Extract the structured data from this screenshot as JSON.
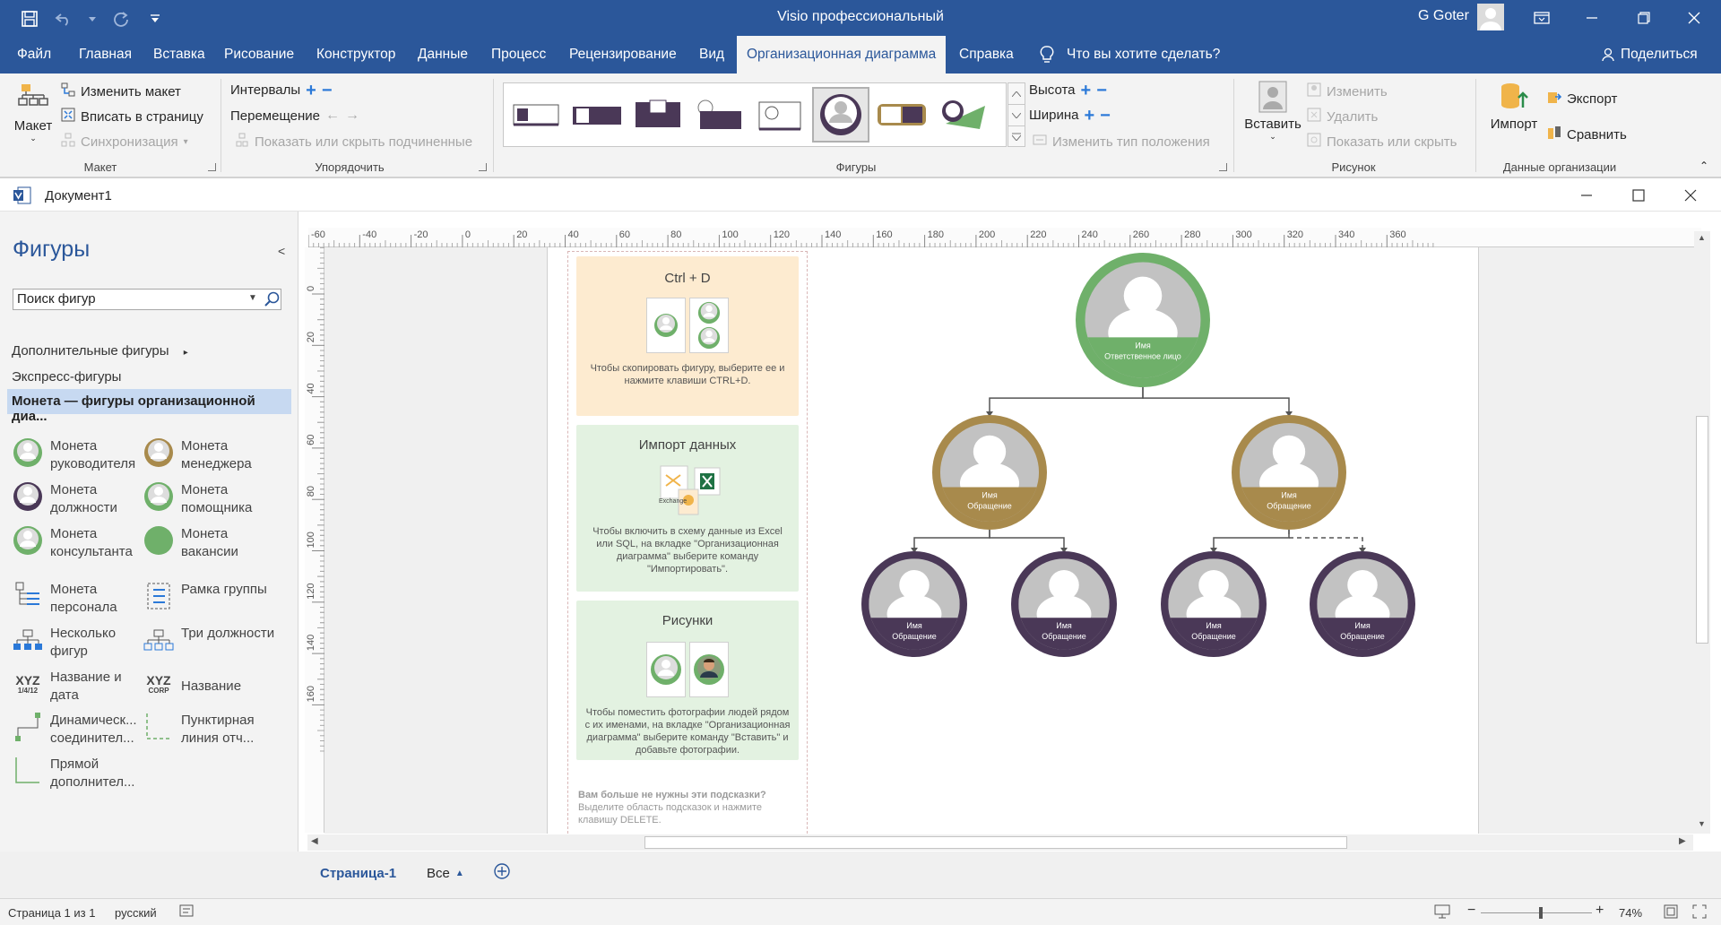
{
  "app": {
    "title": "Visio профессиональный",
    "user": "G Goter",
    "doc_title": "Документ1"
  },
  "tabs": [
    {
      "label": "Файл"
    },
    {
      "label": "Главная"
    },
    {
      "label": "Вставка"
    },
    {
      "label": "Рисование"
    },
    {
      "label": "Конструктор"
    },
    {
      "label": "Данные"
    },
    {
      "label": "Процесс"
    },
    {
      "label": "Рецензирование"
    },
    {
      "label": "Вид"
    },
    {
      "label": "Организационная диаграмма"
    },
    {
      "label": "Справка"
    }
  ],
  "tell_me": "Что вы хотите сделать?",
  "share": "Поделиться",
  "ribbon": {
    "layout": {
      "big_button": "Макет",
      "change_layout": "Изменить макет",
      "fit_to_page": "Вписать в страницу",
      "sync": "Синхронизация",
      "label": "Макет"
    },
    "arrange": {
      "spacing": "Интервалы",
      "move": "Перемещение",
      "show_hide": "Показать или скрыть подчиненные",
      "label": "Упорядочить"
    },
    "shapes": {
      "height": "Высота",
      "width": "Ширина",
      "change_position_type": "Изменить тип положения",
      "label": "Фигуры"
    },
    "picture": {
      "insert": "Вставить",
      "change": "Изменить",
      "delete": "Удалить",
      "show_hide": "Показать или скрыть",
      "label": "Рисунок"
    },
    "org_data": {
      "import": "Импорт",
      "export": "Экспорт",
      "compare": "Сравнить",
      "label": "Данные организации"
    }
  },
  "shapes_pane": {
    "title": "Фигуры",
    "search_placeholder": "Поиск фигур",
    "more_shapes": "Дополнительные фигуры",
    "quick_shapes": "Экспресс-фигуры",
    "stencil": "Монета — фигуры организационной диа...",
    "items": [
      {
        "label": "Монета руководителя",
        "color": "#6fb06a"
      },
      {
        "label": "Монета менеджера",
        "color": "#a88a4c"
      },
      {
        "label": "Монета должности",
        "color": "#4a3857"
      },
      {
        "label": "Монета помощника",
        "color": "#6fb06a"
      },
      {
        "label": "Монета консультанта",
        "color": "#6fb06a"
      },
      {
        "label": "Монета вакансии",
        "color": "#6fb06a"
      },
      {
        "label": "Монета персонала"
      },
      {
        "label": "Рамка группы"
      },
      {
        "label": "Несколько фигур"
      },
      {
        "label": "Три должности"
      },
      {
        "label": "Название и дата",
        "icon_text": "XYZ",
        "icon_sub": "1/4/12"
      },
      {
        "label": "Название",
        "icon_text": "XYZ",
        "icon_sub": "CORP"
      },
      {
        "label": "Динамическ... соединител..."
      },
      {
        "label": "Пунктирная линия отч..."
      },
      {
        "label": "Прямой дополнител..."
      }
    ]
  },
  "ruler": {
    "h_labels": [
      "-60",
      "-40",
      "-20",
      "0",
      "20",
      "40",
      "60",
      "80",
      "100",
      "120",
      "140",
      "160",
      "180",
      "200",
      "220",
      "240",
      "260",
      "280",
      "300",
      "320",
      "340",
      "360"
    ],
    "v_labels": [
      "0",
      "20",
      "40",
      "60",
      "80",
      "100",
      "120",
      "140",
      "160"
    ]
  },
  "tips": [
    {
      "title": "Ctrl + D",
      "desc": "Чтобы скопировать фигуру, выберите ее и нажмите клавиши CTRL+D."
    },
    {
      "title": "Импорт данных",
      "desc": "Чтобы включить в схему данные из Excel или SQL, на вкладке \"Организационная диаграмма\" выберите команду \"Импортировать\".",
      "icon_text": "Exchange"
    },
    {
      "title": "Рисунки",
      "desc": "Чтобы поместить фотографии людей рядом с их именами, на вкладке \"Организационная диаграмма\" выберите команду \"Вставить\" и добавьте фотографии."
    }
  ],
  "tips_footer": {
    "title": "Вам больше не нужны эти подсказки?",
    "desc": "Выделите область подсказок и нажмите клавишу DELETE."
  },
  "org_nodes": [
    {
      "name": "Имя",
      "title": "Ответственное лицо",
      "level": "executive",
      "color": "#6fb06a"
    },
    {
      "name": "Имя",
      "title": "Обращение",
      "level": "manager",
      "color": "#a88a4c"
    },
    {
      "name": "Имя",
      "title": "Обращение",
      "level": "manager",
      "color": "#a88a4c"
    },
    {
      "name": "Имя",
      "title": "Обращение",
      "level": "position",
      "color": "#4a3857"
    },
    {
      "name": "Имя",
      "title": "Обращение",
      "level": "position",
      "color": "#4a3857"
    },
    {
      "name": "Имя",
      "title": "Обращение",
      "level": "position",
      "color": "#4a3857"
    },
    {
      "name": "Имя",
      "title": "Обращение",
      "level": "position",
      "color": "#4a3857"
    }
  ],
  "page_tabs": {
    "page1": "Страница-1",
    "all": "Все"
  },
  "status": {
    "page": "Страница 1 из 1",
    "lang": "русский",
    "zoom": "74%",
    "zoom_value": 74
  },
  "colors": {
    "accent": "#2b579a",
    "tip_orange": "#fdebd0",
    "tip_green": "#e3f2e1"
  }
}
